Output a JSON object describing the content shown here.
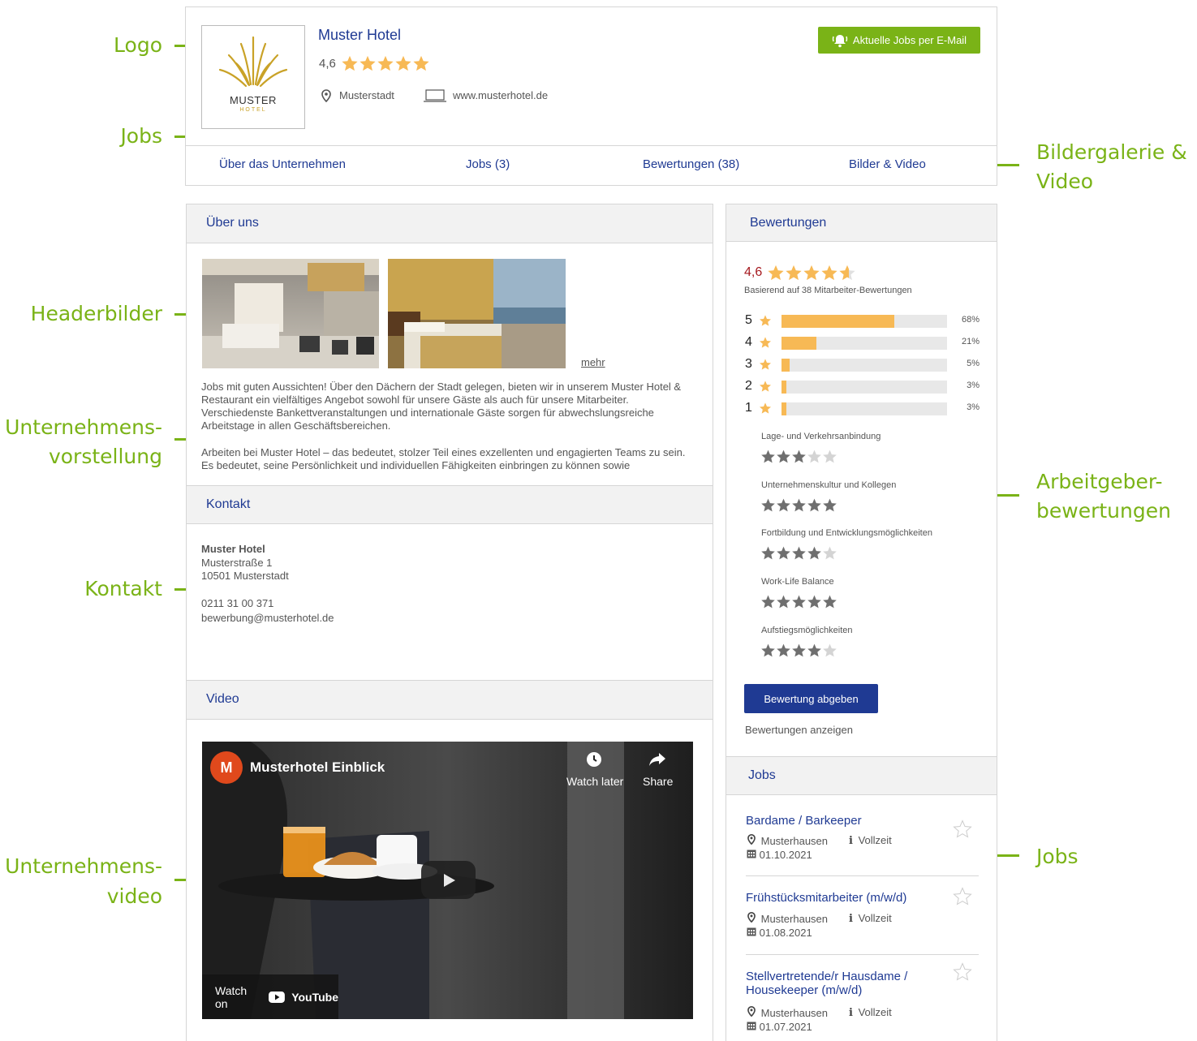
{
  "annotations": {
    "logo": "Logo",
    "jobs_top": "Jobs",
    "gallery_line1": "Bildergalerie &",
    "gallery_line2": "Video",
    "header_images": "Headerbilder",
    "company_intro_line1": "Unternehmens-",
    "company_intro_line2": "vorstellung",
    "contact": "Kontakt",
    "company_video_line1": "Unternehmens-",
    "company_video_line2": "video",
    "employer_reviews_line1": "Arbeitgeber-",
    "employer_reviews_line2": "bewertungen",
    "jobs_side": "Jobs"
  },
  "company": {
    "name": "Muster Hotel",
    "rating": "4,6",
    "rating_value": 4.6,
    "city": "Musterstadt",
    "website": "www.musterhotel.de",
    "logo_text": "MUSTER",
    "logo_subtext": "HOTEL",
    "job_alert_button": "Aktuelle Jobs per E-Mail"
  },
  "tabs": [
    "Über das Unternehmen",
    "Jobs (3)",
    "Bewertungen (38)",
    "Bilder & Video"
  ],
  "about": {
    "title": "Über uns",
    "more_link": "mehr",
    "paragraph1": "Jobs mit guten Aussichten! Über den Dächern der Stadt gelegen, bieten wir in unserem Muster Hotel & Restaurant ein vielfältiges Angebot sowohl für unsere Gäste als auch für unsere Mitarbeiter. Verschiedenste Bankettveranstaltungen und internationale Gäste sorgen für abwechslungsreiche Arbeitstage in allen Geschäftsbereichen.",
    "paragraph2": "Arbeiten bei Muster Hotel – das bedeutet, stolzer Teil eines exzellenten und engagierten Teams zu sein. Es bedeutet, seine Persönlichkeit und individuellen Fähigkeiten einbringen zu können sowie"
  },
  "contact": {
    "title": "Kontakt",
    "name": "Muster Hotel",
    "street": "Musterstraße 1",
    "city": "10501 Musterstadt",
    "phone": "0211 31 00 371",
    "email": "bewerbung@musterhotel.de"
  },
  "video": {
    "title": "Video",
    "channel_initial": "M",
    "video_title": "Musterhotel Einblick",
    "watch_later": "Watch later",
    "share": "Share",
    "watch_on": "Watch on",
    "youtube": "YouTube"
  },
  "reviews": {
    "title": "Bewertungen",
    "score": "4,6",
    "score_value": 4.6,
    "basis": "Basierend auf 38 Mitarbeiter-Bewertungen",
    "distribution": [
      {
        "stars": "5",
        "percent_label": "68%",
        "percent": 68
      },
      {
        "stars": "4",
        "percent_label": "21%",
        "percent": 21
      },
      {
        "stars": "3",
        "percent_label": "5%",
        "percent": 5
      },
      {
        "stars": "2",
        "percent_label": "3%",
        "percent": 3
      },
      {
        "stars": "1",
        "percent_label": "3%",
        "percent": 3
      }
    ],
    "categories": [
      {
        "label": "Lage- und Verkehrsanbindung",
        "stars": 3
      },
      {
        "label": "Unternehmenskultur und Kollegen",
        "stars": 5
      },
      {
        "label": "Fortbildung und Entwicklungsmöglichkeiten",
        "stars": 4
      },
      {
        "label": "Work-Life Balance",
        "stars": 5
      },
      {
        "label": "Aufstiegsmöglichkeiten",
        "stars": 4
      }
    ],
    "submit_button": "Bewertung abgeben",
    "show_link": "Bewertungen anzeigen"
  },
  "jobs": {
    "title": "Jobs",
    "items": [
      {
        "title": "Bardame / Barkeeper",
        "location": "Musterhausen",
        "type": "Vollzeit",
        "date": "01.10.2021"
      },
      {
        "title": "Frühstücksmitarbeiter (m/w/d)",
        "location": "Musterhausen",
        "type": "Vollzeit",
        "date": "01.08.2021"
      },
      {
        "title_line1": "Stellvertretende/r Hausdame /",
        "title_line2": "Housekeeper (m/w/d)",
        "location": "Musterhausen",
        "type": "Vollzeit",
        "date": "01.07.2021"
      }
    ]
  },
  "colors": {
    "accent_green": "#7ab317",
    "navy": "#1f3a93",
    "star_gold": "#f7b955",
    "star_grey": "#6f6f6f",
    "score_red": "#a5181e"
  }
}
